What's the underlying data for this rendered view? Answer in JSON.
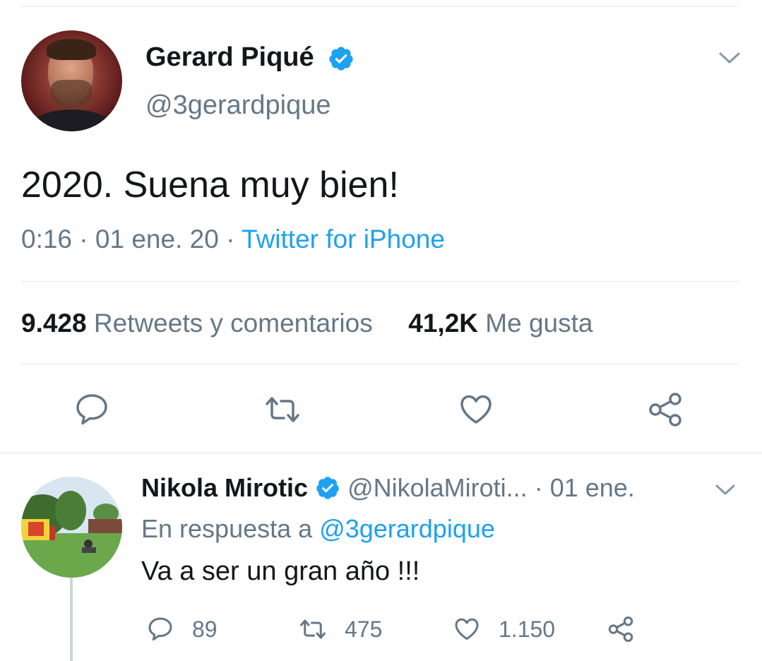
{
  "main_tweet": {
    "author_name": "Gerard Piqué",
    "author_handle": "@3gerardpique",
    "text": "2020. Suena muy bien!",
    "time": "0:16",
    "date": "01 ene. 20",
    "source": "Twitter for iPhone",
    "retweets_count": "9.428",
    "retweets_label": "Retweets y comentarios",
    "likes_count": "41,2K",
    "likes_label": "Me gusta",
    "actions": [
      "reply-icon",
      "retweet-icon",
      "like-icon",
      "share-icon"
    ]
  },
  "reply_tweet": {
    "author_name": "Nikola Mirotic",
    "author_handle": "@NikolaMiroti...",
    "date": "01 ene.",
    "reply_prefix": "En respuesta a",
    "reply_to": "@3gerardpique",
    "text": "Va a ser un gran año !!!",
    "reply_count": "89",
    "retweet_count": "475",
    "like_count": "1.150"
  },
  "colors": {
    "accent": "#1da1f2",
    "secondary_text": "#657786",
    "primary_text": "#14171a",
    "divider": "#e1e8ed"
  }
}
